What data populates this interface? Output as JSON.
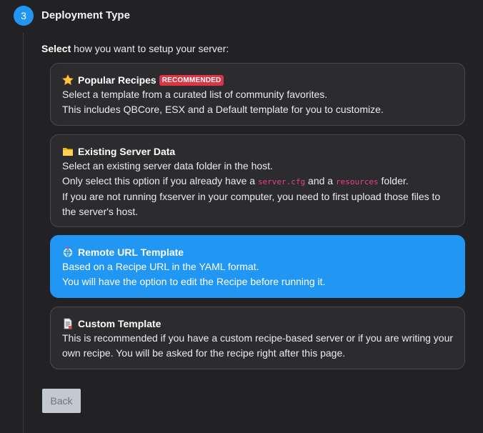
{
  "step": {
    "number": "3",
    "title": "Deployment Type"
  },
  "intro": {
    "bold": "Select",
    "rest": " how you want to setup your server:"
  },
  "options": [
    {
      "title": "Popular Recipes",
      "badge": "RECOMMENDED",
      "icon": "star-icon",
      "lines": [
        "Select a template from a curated list of community favorites.",
        "This includes QBCore, ESX and a Default template for you to customize."
      ]
    },
    {
      "title": "Existing Server Data",
      "icon": "folder-icon",
      "line1": "Select an existing server data folder in the host.",
      "line2_a": "Only select this option if you already have a ",
      "line2_code1": "server.cfg",
      "line2_b": " and a ",
      "line2_code2": "resources",
      "line2_c": " folder.",
      "line3": "If you are not running fxserver in your computer, you need to first upload those files to",
      "line4": "the server's host."
    },
    {
      "title": "Remote URL Template",
      "icon": "globe-icon",
      "selected": true,
      "lines": [
        "Based on a Recipe URL in the YAML format.",
        "You will have the option to edit the Recipe before running it."
      ]
    },
    {
      "title": "Custom Template",
      "icon": "document-icon",
      "lines": [
        "This is recommended if you have a custom recipe-based server or if you are writing your",
        "own recipe. You will be asked for the recipe right after this page."
      ]
    }
  ],
  "back_label": "Back",
  "colors": {
    "accent": "#2196f3",
    "badge": "#dc3545",
    "code": "#e83e8c"
  }
}
